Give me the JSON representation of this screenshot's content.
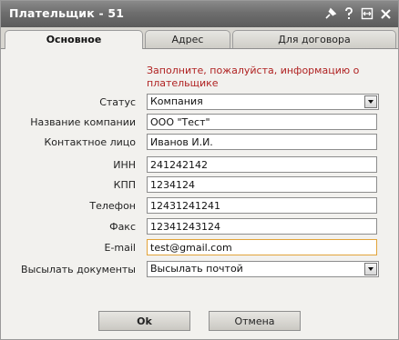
{
  "window": {
    "title": "Плательщик - 51"
  },
  "titlebar_icons": [
    "pin-icon",
    "help-icon",
    "restore-icon",
    "close-icon"
  ],
  "tabs": [
    {
      "label": "Основное",
      "active": true
    },
    {
      "label": "Адрес",
      "active": false
    },
    {
      "label": "Для договора",
      "active": false
    }
  ],
  "notice": "Заполните, пожалуйста, информацию о плательщике",
  "form": {
    "status": {
      "label": "Статус",
      "value": "Компания"
    },
    "company_name": {
      "label": "Название компании",
      "value": "ООО \"Тест\""
    },
    "contact": {
      "label": "Контактное лицо",
      "value": "Иванов И.И."
    },
    "inn": {
      "label": "ИНН",
      "value": "241242142"
    },
    "kpp": {
      "label": "КПП",
      "value": "1234124"
    },
    "phone": {
      "label": "Телефон",
      "value": "12431241241"
    },
    "fax": {
      "label": "Факс",
      "value": "12341243124"
    },
    "email": {
      "label": "E-mail",
      "value": "test@gmail.com"
    },
    "send_docs": {
      "label": "Высылать документы",
      "value": "Высылать почтой"
    }
  },
  "buttons": {
    "ok": "Ok",
    "cancel": "Отмена"
  },
  "colors": {
    "titlebar": "#6e6e6e",
    "notice": "#b02222",
    "focus_border": "#e2a43a",
    "panel": "#f2f1ee"
  }
}
